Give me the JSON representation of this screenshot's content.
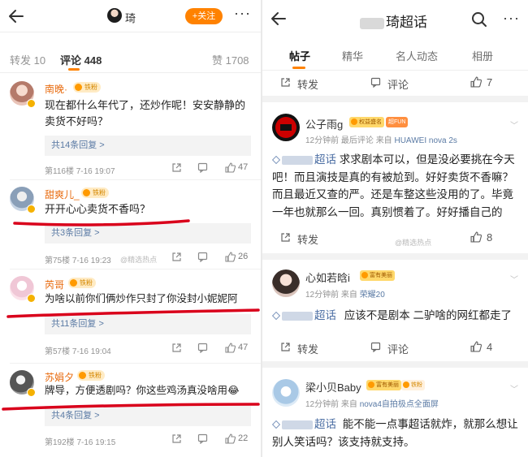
{
  "left": {
    "header": {
      "user_name": "琦",
      "follow_label": "+关注",
      "more_glyph": "···"
    },
    "tabs": {
      "reposts": "转发 10",
      "comments": "评论 448",
      "likes": "赞 1708"
    },
    "comments": [
      {
        "user": "南晚·",
        "fan_badge": "铁粉",
        "text_line1": "现在都什么年代了，还炒作呢！安安静静的",
        "text_line2": "卖货不好吗？",
        "reply": "共14条回复 >",
        "meta": "第116楼  7-16 19:07",
        "likes": "47"
      },
      {
        "user": "甜爽儿_",
        "fan_badge": "铁粉",
        "text": "开开心心卖货不香吗？",
        "reply": "共3条回复 >",
        "meta": "第75楼  7-16 19:23",
        "likes": "26",
        "watermark": "@精选热点"
      },
      {
        "user": "芮哥",
        "fan_badge": "铁粉",
        "text": "为啥以前你们俩炒作只封了你没封小妮妮阿",
        "reply": "共11条回复 >",
        "meta": "第57楼  7-16 19:04",
        "likes": "47"
      },
      {
        "user": "苏娟夕",
        "fan_badge": "铁粉",
        "text": "牌导，方便透剧吗？你这些鸡汤真没啥用😂",
        "reply": "共4条回复 >",
        "meta": "第192楼  7-16 19:15",
        "likes": "22"
      }
    ]
  },
  "right": {
    "header": {
      "title": "琦超话",
      "more_glyph": "···"
    },
    "tabs": [
      "帖子",
      "精华",
      "名人动态",
      "相册"
    ],
    "top_actions": {
      "repost": "转发",
      "comment": "评论",
      "likes": "7"
    },
    "posts": [
      {
        "user": "公子雨g",
        "badge1": "权益盛名",
        "badge2": "超FUN",
        "sub_time": "12分钟前",
        "sub_label": "最后评论",
        "sub_from": "来自",
        "sub_device": "HUAWEI nova 2s",
        "topic": "超话",
        "body": "求求剧本可以，但是没必要挑在今天吧！而且演技是真的有被尬到。好好卖货不香嘛？而且最近又查的严。还是车整这些没用的了。毕竟一年也就那么一回。真别惯着了。好好播自己的",
        "repost": "转发",
        "likes": "8",
        "watermark": "@精选热点"
      },
      {
        "user": "心如若晗i",
        "badge1": "富有美丽",
        "sub_time": "12分钟前",
        "sub_from": "来自",
        "sub_device": "荣耀20",
        "topic": "超话",
        "body": "应该不是剧本 二驴啥的网红都走了",
        "repost": "转发",
        "comment": "评论",
        "likes": "4"
      },
      {
        "user": "梁小贝Baby",
        "badge1": "富有美丽",
        "badge2": "铁粉",
        "sub_time": "12分钟前",
        "sub_from": "来自",
        "sub_device": "nova4自拍极点全面屏",
        "topic": "超话",
        "body": "能不能一点事超话就炸，就那么想让别人笑话吗？该支持就支持。"
      }
    ]
  },
  "colors": {
    "accent": "#ff8200",
    "link": "#4b6ea3",
    "red_mark": "#d9001b"
  }
}
